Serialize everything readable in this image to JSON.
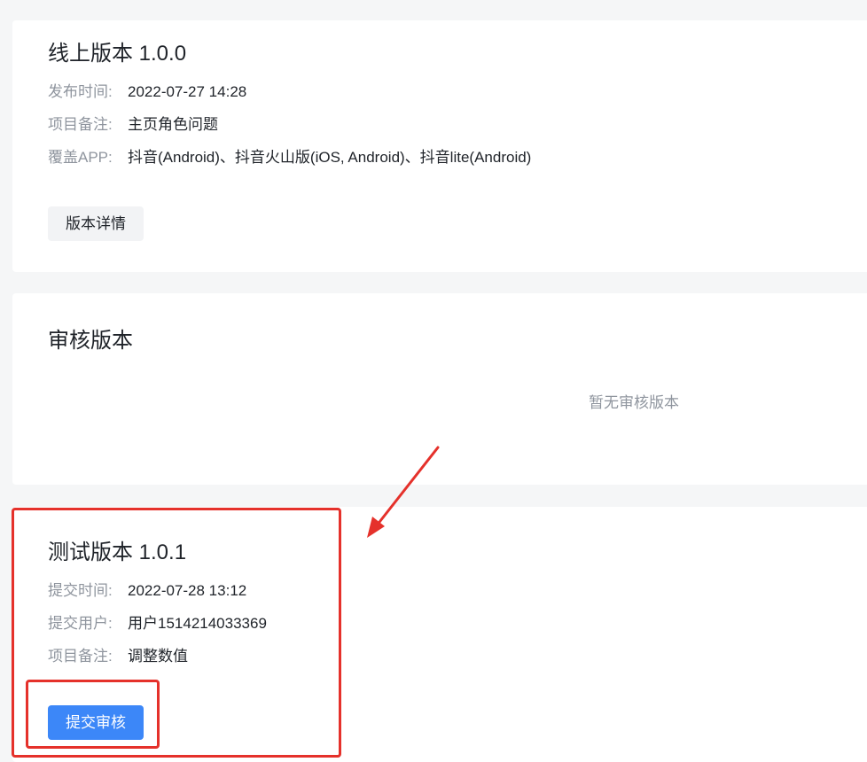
{
  "online": {
    "title": "线上版本 1.0.0",
    "rows": [
      {
        "label": "发布时间:",
        "value": "2022-07-27 14:28"
      },
      {
        "label": "项目备注:",
        "value": "主页角色问题"
      },
      {
        "label": "覆盖APP:",
        "value": "抖音(Android)、抖音火山版(iOS, Android)、抖音lite(Android)"
      }
    ],
    "button_label": "版本详情"
  },
  "review": {
    "title": "审核版本",
    "empty_text": "暂无审核版本"
  },
  "test": {
    "title": "测试版本 1.0.1",
    "rows": [
      {
        "label": "提交时间:",
        "value": "2022-07-28 13:12"
      },
      {
        "label": "提交用户:",
        "value": "用户1514214033369"
      },
      {
        "label": "项目备注:",
        "value": "调整数值"
      }
    ],
    "button_label": "提交审核"
  },
  "colors": {
    "primary": "#3c87f8",
    "annotation": "#e5312b",
    "label_text": "#8f959e",
    "body_text": "#1f2329"
  }
}
